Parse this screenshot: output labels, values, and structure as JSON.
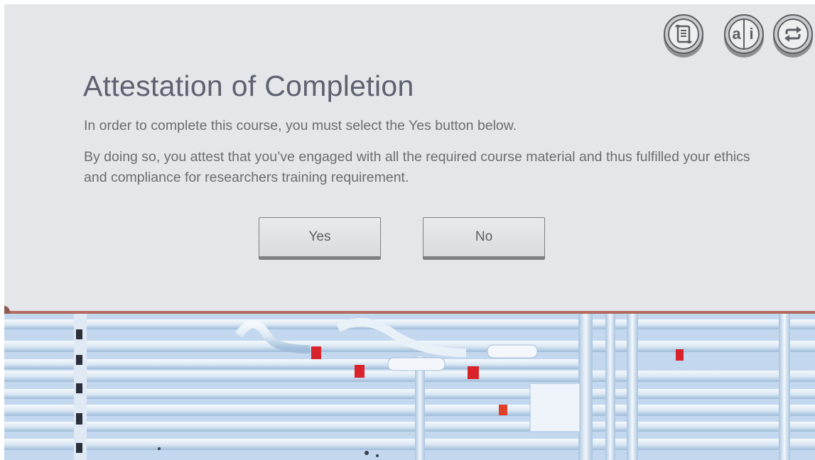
{
  "toolbar": {
    "icons": [
      {
        "name": "transcript-icon"
      },
      {
        "name": "glossary-icon",
        "letters": [
          "a",
          "i"
        ]
      },
      {
        "name": "replay-icon"
      }
    ]
  },
  "dialog": {
    "title": "Attestation of Completion",
    "instruction": "In order to complete this course, you must select the Yes button below.",
    "attestation": "By doing so, you attest that you’ve engaged with all the required course material and thus fulfilled your ethics and compliance for researchers training requirement.",
    "yes_label": "Yes",
    "no_label": "No"
  },
  "colors": {
    "panel_bg": "#e4e6e9",
    "title": "#5d6170",
    "divider": "#b36a5f",
    "marker_red": "#d8232a"
  }
}
